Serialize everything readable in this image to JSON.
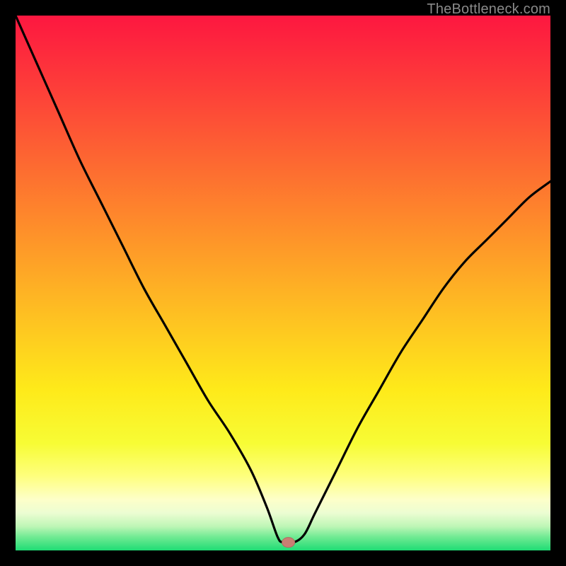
{
  "watermark": {
    "text": "TheBottleneck.com"
  },
  "colors": {
    "background": "#000000",
    "curve": "#000000",
    "marker_fill": "#ca7e73",
    "marker_stroke": "#b36a60",
    "gradient_stops": [
      {
        "offset": 0.0,
        "color": "#fd1740"
      },
      {
        "offset": 0.14,
        "color": "#fd3f39"
      },
      {
        "offset": 0.28,
        "color": "#fd6a31"
      },
      {
        "offset": 0.42,
        "color": "#fe9529"
      },
      {
        "offset": 0.56,
        "color": "#fec022"
      },
      {
        "offset": 0.7,
        "color": "#feea1a"
      },
      {
        "offset": 0.8,
        "color": "#f7fc35"
      },
      {
        "offset": 0.86,
        "color": "#feff7c"
      },
      {
        "offset": 0.905,
        "color": "#fdffc9"
      },
      {
        "offset": 0.93,
        "color": "#ecfdd2"
      },
      {
        "offset": 0.955,
        "color": "#bef6b6"
      },
      {
        "offset": 0.975,
        "color": "#70ea93"
      },
      {
        "offset": 1.0,
        "color": "#1fdc74"
      }
    ]
  },
  "chart_data": {
    "type": "line",
    "title": "",
    "xlabel": "",
    "ylabel": "",
    "xlim": [
      0,
      100
    ],
    "ylim": [
      0,
      100
    ],
    "x": [
      0,
      4,
      8,
      12,
      16,
      20,
      24,
      28,
      32,
      36,
      40,
      44,
      47,
      49,
      50,
      52,
      54,
      56,
      60,
      64,
      68,
      72,
      76,
      80,
      84,
      88,
      92,
      96,
      100
    ],
    "values": [
      100,
      91,
      82,
      73,
      65,
      57,
      49,
      42,
      35,
      28,
      22,
      15,
      8,
      2.5,
      1.5,
      1.5,
      3,
      7,
      15,
      23,
      30,
      37,
      43,
      49,
      54,
      58,
      62,
      66,
      69
    ],
    "marker": {
      "x": 51,
      "y": 1.5,
      "shape": "ellipse"
    },
    "notes": "values are bottleneck-percentage (distance from bottom); curve dips to near 0 around x≈49–52 then rises; values estimated from pixel position"
  }
}
